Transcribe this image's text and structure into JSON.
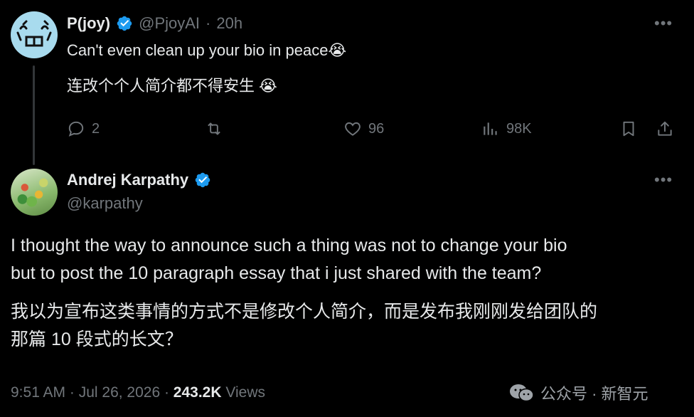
{
  "reply": {
    "name": "P(joy)",
    "handle": "@PjoyAI",
    "separator": "·",
    "time": "20h",
    "text_en": "Can't even clean up your bio in peace",
    "emoji": "😭",
    "text_zh": "连改个个人简介都不得安生",
    "actions": {
      "replies": "2",
      "likes": "96",
      "views": "98K"
    }
  },
  "main": {
    "name": "Andrej Karpathy",
    "handle": "@karpathy",
    "line1": "I thought the way to announce such a thing was not to change your bio",
    "line2": "but to post the 10 paragraph essay that i just shared with the team?",
    "zh_line1": "我以为宣布这类事情的方式不是修改个人简介，而是发布我刚刚发给团队的",
    "zh_line2": "那篇 10 段式的长文？",
    "footer": {
      "time": "9:51 AM · Jul 26, 2026 · ",
      "views_count": "243.2K",
      "views_label": " Views"
    }
  },
  "watermark": {
    "text": "公众号 · 新智元"
  },
  "colors": {
    "background": "#000000",
    "text": "#e7e9ea",
    "muted": "#71767b",
    "verified": "#1d9bf0"
  }
}
